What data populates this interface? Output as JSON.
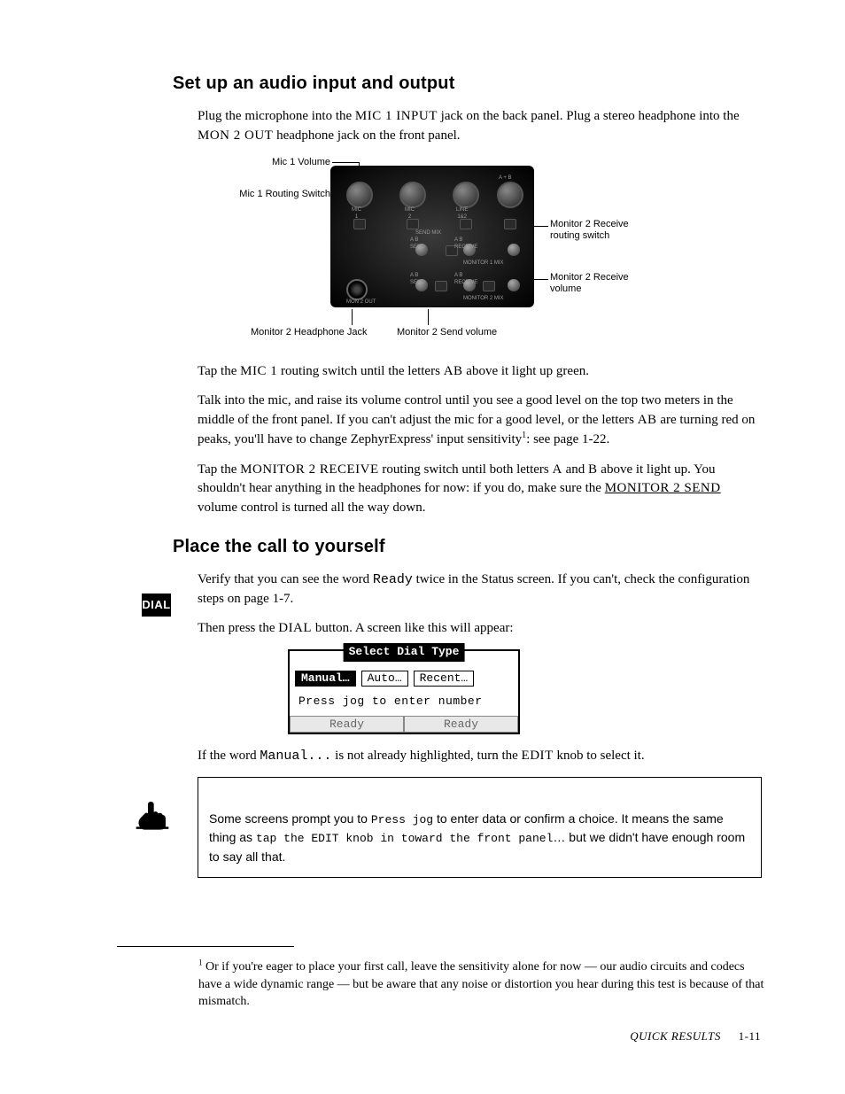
{
  "section1": {
    "heading": "Set up an audio input and output",
    "p1a": "Plug the microphone into the ",
    "p1b": "MIC 1 INPUT",
    "p1c": " jack on the back panel. Plug a stereo headphone into the ",
    "p1d": "MON 2 OUT",
    "p1e": " headphone jack on the front panel.",
    "fig": {
      "c_mic1vol": "Mic 1 Volume",
      "c_mic1route": "Mic 1 Routing Switch",
      "c_mon2hp": "Monitor 2 Headphone Jack",
      "c_mon2send": "Monitor 2 Send volume",
      "c_mon2rxsw": "Monitor 2 Receive\nrouting switch",
      "c_mon2rxvol": "Monitor 2 Receive\nvolume",
      "pl_mic1": "MIC\n1",
      "pl_mic2": "MIC\n2",
      "pl_line": "LINE\n1&2",
      "pl_ab_top": "A + B",
      "pl_sendmix": "SEND MIX",
      "pl_ab_send_l": "A  B\nSEND",
      "pl_ab_recv_r": "A  B\nRECEIVE",
      "pl_mon1mix": "MONITOR 1 MIX",
      "pl_mon2out": "MON 2 OUT",
      "pl_mon2mix": "MONITOR 2 MIX"
    },
    "p2a": "Tap the ",
    "p2b": "MIC 1",
    "p2c": " routing switch until the letters ",
    "p2d": "AB",
    "p2e": " above it light up green.",
    "p3a": "Talk into the mic, and raise its volume control until you see a good level on the top two meters in the middle of the front panel. If you can't adjust the mic for a good level, or the letters ",
    "p3b": "AB",
    "p3c": " are turning red on peaks, you'll have to change ZephyrExpress' input sensitivity",
    "p3sup": "1",
    "p3d": ": see page 1-22.",
    "p4a": "Tap the ",
    "p4b": "MONITOR 2 RECEIVE",
    "p4c": " routing switch until both letters ",
    "p4d": "A",
    "p4e": " and ",
    "p4f": "B",
    "p4g": " above it light up. You shouldn't hear anything in the headphones for now: if you do, make sure the ",
    "p4h": "MONITOR 2 SEND",
    "p4i": " volume control is turned all the way down."
  },
  "section2": {
    "heading": "Place the call to yourself",
    "dial_label": "DIAL",
    "p1a": "Verify that you can see the word ",
    "p1b": "Ready",
    "p1c": " twice in the Status screen. If you can't, check the configuration steps on page 1-7.",
    "p2a": "Then press the ",
    "p2b": "DIAL",
    "p2c": " button. A screen like this will appear:",
    "lcd": {
      "title": "Select Dial Type",
      "opt1": "Manual…",
      "opt2": "Auto…",
      "opt3": "Recent…",
      "prompt": "Press jog to enter number",
      "status_l": "Ready",
      "status_r": "Ready"
    },
    "p3a": "If the word ",
    "p3b": "Manual...",
    "p3c": " is not already highlighted, turn the ",
    "p3d": "EDIT",
    "p3e": " knob to select it.",
    "tip_a": "Some screens prompt you to ",
    "tip_b": "Press jog",
    "tip_c": " to enter data or confirm a choice. It means the same thing as ",
    "tip_d": "tap the EDIT knob in toward the front panel",
    "tip_e": "… but we didn't have enough room to say all that."
  },
  "footnote": {
    "num": "1",
    "text": " Or if you're eager to place your first call, leave the sensitivity alone for now — our audio circuits and codecs have a wide dynamic range — but be aware that any noise or distortion you hear during this test is because of that mismatch."
  },
  "footer": {
    "section": "QUICK RESULTS",
    "page": "1-11"
  }
}
